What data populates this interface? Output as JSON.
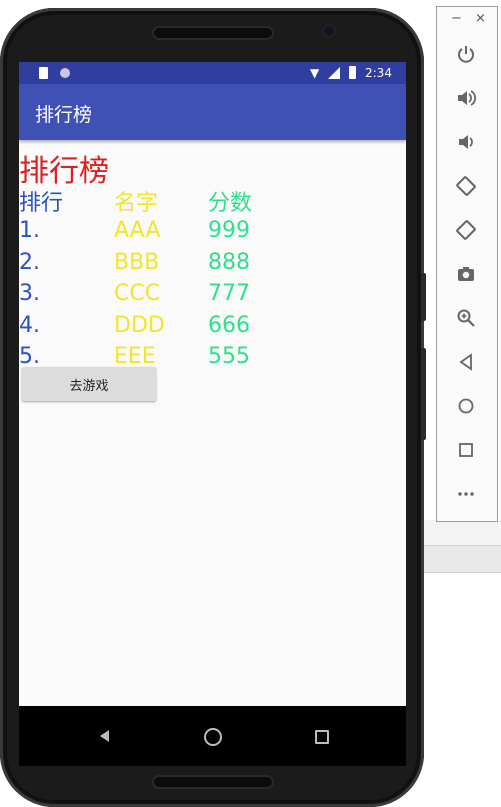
{
  "status_bar": {
    "time": "2:34"
  },
  "app_bar": {
    "title": "排行榜"
  },
  "leaderboard": {
    "heading": "排行榜",
    "columns": [
      "排行",
      "名字",
      "分数"
    ],
    "rows": [
      [
        "1.",
        "AAA",
        "999"
      ],
      [
        "2.",
        "BBB",
        "888"
      ],
      [
        "3.",
        "CCC",
        "777"
      ],
      [
        "4.",
        "DDD",
        "666"
      ],
      [
        "5.",
        "EEE",
        "555"
      ]
    ],
    "colors": {
      "heading": "#e02020",
      "rank": "#2a52be",
      "name": "#f2e52a",
      "score": "#2fe08a"
    }
  },
  "buttons": {
    "go_game": "去游戏"
  },
  "emulator_panel": {
    "minimize": "−",
    "close": "×",
    "controls": [
      "power-icon",
      "volume-up-icon",
      "volume-down-icon",
      "rotate-left-icon",
      "rotate-right-icon",
      "camera-icon",
      "zoom-icon",
      "back-icon",
      "home-icon",
      "overview-icon",
      "more-icon"
    ]
  }
}
